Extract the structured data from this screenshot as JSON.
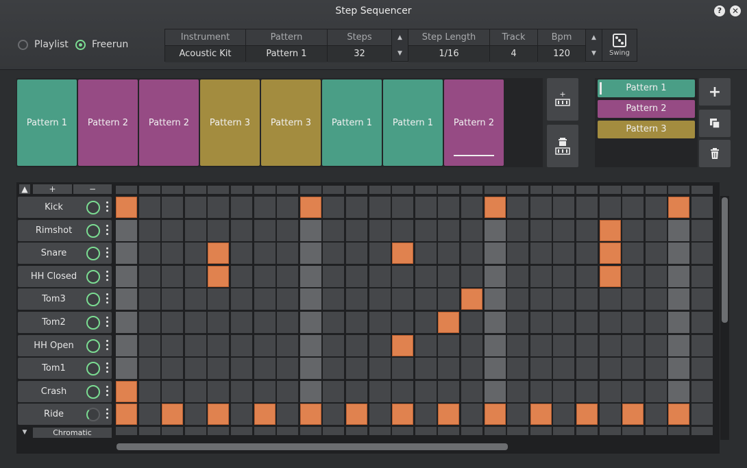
{
  "window": {
    "title": "Step Sequencer",
    "help": "?",
    "close": "✕"
  },
  "mode": {
    "playlist_label": "Playlist",
    "freerun_label": "Freerun",
    "selected": "Freerun"
  },
  "params": {
    "instrument_label": "Instrument",
    "instrument": "Acoustic Kit",
    "pattern_label": "Pattern",
    "pattern": "Pattern 1",
    "steps_label": "Steps",
    "steps": "32",
    "step_length_label": "Step Length",
    "step_length": "1/16",
    "track_label": "Track",
    "track": "4",
    "bpm_label": "Bpm",
    "bpm": "120",
    "swing_label": "Swing",
    "up_arrow": "▲",
    "down_arrow": "▼"
  },
  "strip": {
    "tiles": [
      {
        "label": "Pattern 1",
        "color": "#4a9e86"
      },
      {
        "label": "Pattern 2",
        "color": "#964b84"
      },
      {
        "label": "Pattern 2",
        "color": "#964b84"
      },
      {
        "label": "Pattern 3",
        "color": "#a38c3f"
      },
      {
        "label": "Pattern 3",
        "color": "#a38c3f"
      },
      {
        "label": "Pattern 1",
        "color": "#4a9e86"
      },
      {
        "label": "Pattern 1",
        "color": "#4a9e86"
      },
      {
        "label": "Pattern 2",
        "color": "#964b84"
      }
    ],
    "add_icon": "+",
    "delete_icon": "🗑"
  },
  "pattern_list": {
    "items": [
      {
        "label": "Pattern 1",
        "color": "#4a9e86"
      },
      {
        "label": "Pattern 2",
        "color": "#964b84"
      },
      {
        "label": "Pattern 3",
        "color": "#a38c3f"
      }
    ],
    "add": "+",
    "duplicate": "⧉",
    "delete": "🗑"
  },
  "grid": {
    "add_track": "+",
    "remove_track": "−",
    "collapse": "▲",
    "expand": "▼",
    "chromatic_label": "Chromatic",
    "tracks": [
      {
        "name": "Kick",
        "level": "high",
        "steps_on": [
          0,
          8,
          16,
          24
        ]
      },
      {
        "name": "Rimshot",
        "level": "high",
        "steps_on": [
          21
        ]
      },
      {
        "name": "Snare",
        "level": "high",
        "steps_on": [
          4,
          12,
          21
        ]
      },
      {
        "name": "HH Closed",
        "level": "high",
        "steps_on": [
          4,
          21
        ]
      },
      {
        "name": "Tom3",
        "level": "high",
        "steps_on": [
          15
        ]
      },
      {
        "name": "Tom2",
        "level": "high",
        "steps_on": [
          14
        ]
      },
      {
        "name": "HH Open",
        "level": "high",
        "steps_on": [
          12
        ]
      },
      {
        "name": "Tom1",
        "level": "high",
        "steps_on": []
      },
      {
        "name": "Crash",
        "level": "high",
        "steps_on": [
          0
        ]
      },
      {
        "name": "Ride",
        "level": "low",
        "steps_on": [
          0,
          2,
          4,
          6,
          8,
          10,
          12,
          14,
          16,
          18,
          20,
          22,
          24
        ]
      }
    ]
  }
}
